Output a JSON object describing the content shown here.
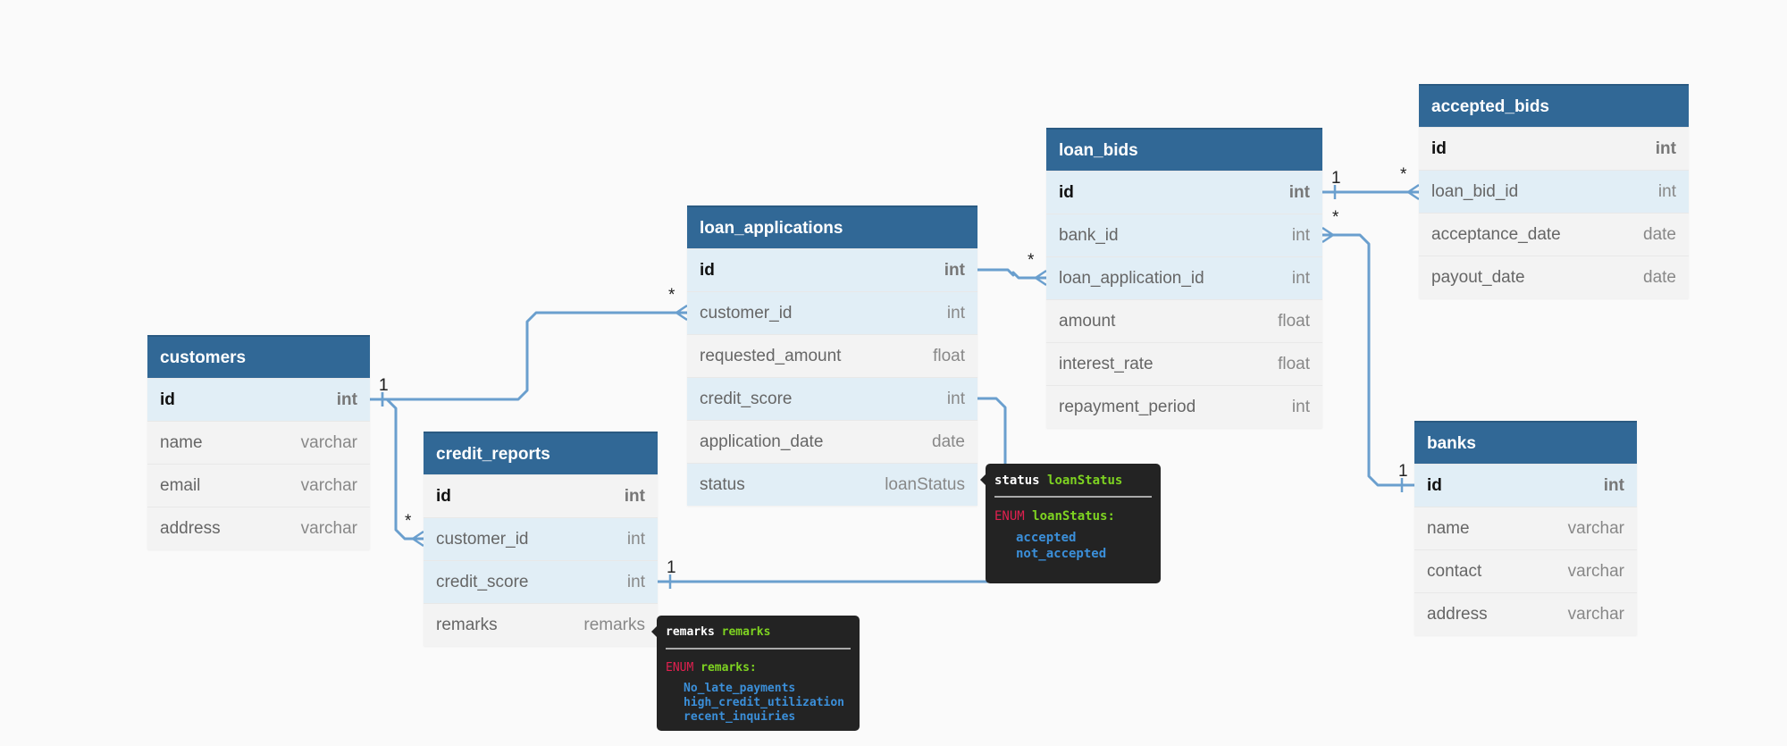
{
  "colors": {
    "header": "#316896",
    "related_row": "#e1eef6",
    "row": "#f3f3f3",
    "link": "#6a9fce"
  },
  "tables": [
    {
      "name": "customers",
      "fields": [
        {
          "name": "id",
          "type": "int",
          "pk": true,
          "rel": true
        },
        {
          "name": "name",
          "type": "varchar"
        },
        {
          "name": "email",
          "type": "varchar"
        },
        {
          "name": "address",
          "type": "varchar"
        }
      ]
    },
    {
      "name": "loan_applications",
      "fields": [
        {
          "name": "id",
          "type": "int",
          "pk": true,
          "rel": true
        },
        {
          "name": "customer_id",
          "type": "int",
          "rel": true
        },
        {
          "name": "requested_amount",
          "type": "float"
        },
        {
          "name": "credit_score",
          "type": "int",
          "rel": true
        },
        {
          "name": "application_date",
          "type": "date"
        },
        {
          "name": "status",
          "type": "loanStatus",
          "rel": true
        }
      ]
    },
    {
      "name": "loan_bids",
      "fields": [
        {
          "name": "id",
          "type": "int",
          "pk": true,
          "rel": true
        },
        {
          "name": "bank_id",
          "type": "int",
          "rel": true
        },
        {
          "name": "loan_application_id",
          "type": "int",
          "rel": true
        },
        {
          "name": "amount",
          "type": "float"
        },
        {
          "name": "interest_rate",
          "type": "float"
        },
        {
          "name": "repayment_period",
          "type": "int"
        }
      ]
    },
    {
      "name": "accepted_bids",
      "fields": [
        {
          "name": "id",
          "type": "int",
          "pk": true
        },
        {
          "name": "loan_bid_id",
          "type": "int",
          "rel": true
        },
        {
          "name": "acceptance_date",
          "type": "date"
        },
        {
          "name": "payout_date",
          "type": "date"
        }
      ]
    },
    {
      "name": "credit_reports",
      "fields": [
        {
          "name": "id",
          "type": "int",
          "pk": true
        },
        {
          "name": "customer_id",
          "type": "int",
          "rel": true
        },
        {
          "name": "credit_score",
          "type": "int",
          "rel": true
        },
        {
          "name": "remarks",
          "type": "remarks"
        }
      ]
    },
    {
      "name": "banks",
      "fields": [
        {
          "name": "id",
          "type": "int",
          "pk": true,
          "rel": true
        },
        {
          "name": "name",
          "type": "varchar"
        },
        {
          "name": "contact",
          "type": "varchar"
        },
        {
          "name": "address",
          "type": "varchar"
        }
      ]
    }
  ],
  "relationships": [
    {
      "from": "customers.id",
      "to": "loan_applications.customer_id",
      "from_card": "1",
      "to_card": "*"
    },
    {
      "from": "customers.id",
      "to": "credit_reports.customer_id",
      "from_card": "1",
      "to_card": "*"
    },
    {
      "from": "loan_applications.id",
      "to": "loan_bids.loan_application_id",
      "from_card": "1",
      "to_card": "*"
    },
    {
      "from": "loan_bids.id",
      "to": "accepted_bids.loan_bid_id",
      "from_card": "1",
      "to_card": "*"
    },
    {
      "from": "banks.id",
      "to": "loan_bids.bank_id",
      "from_card": "1",
      "to_card": "*"
    },
    {
      "from": "credit_reports.credit_score",
      "to": "loan_applications.credit_score",
      "from_card": "1",
      "to_card": "*"
    }
  ],
  "tooltips": [
    {
      "field": "status",
      "type": "loanStatus",
      "keyword": "ENUM",
      "enum_name": "loanStatus:",
      "values": [
        "accepted",
        "not_accepted"
      ]
    },
    {
      "field": "remarks",
      "type": "remarks",
      "keyword": "ENUM",
      "enum_name": "remarks:",
      "values": [
        "No_late_payments",
        "high_credit_utilization",
        "recent_inquiries"
      ]
    }
  ]
}
